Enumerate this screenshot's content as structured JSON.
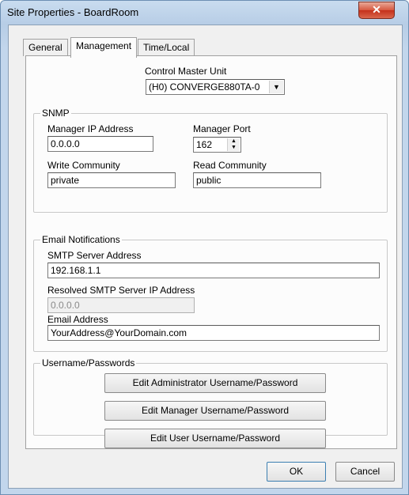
{
  "window": {
    "title": "Site Properties - BoardRoom",
    "close_glyph": "✕"
  },
  "tabs": [
    "General",
    "Management",
    "Time/Local"
  ],
  "control_master": {
    "label": "Control Master Unit",
    "value": "(H0) CONVERGE880TA-0"
  },
  "snmp": {
    "title": "SNMP",
    "manager_ip_label": "Manager IP Address",
    "manager_ip_value": "0.0.0.0",
    "manager_port_label": "Manager Port",
    "manager_port_value": "162",
    "write_community_label": "Write Community",
    "write_community_value": "private",
    "read_community_label": "Read Community",
    "read_community_value": "public"
  },
  "email": {
    "title": "Email Notifications",
    "smtp_label": "SMTP Server Address",
    "smtp_value": "192.168.1.1",
    "resolved_label": "Resolved SMTP Server IP Address",
    "resolved_value": "0.0.0.0",
    "address_label": "Email Address",
    "address_value": "YourAddress@YourDomain.com"
  },
  "passwords": {
    "title": "Username/Passwords",
    "admin_button": "Edit Administrator Username/Password",
    "manager_button": "Edit Manager Username/Password",
    "user_button": "Edit User Username/Password"
  },
  "footer": {
    "ok": "OK",
    "cancel": "Cancel"
  },
  "icons": {
    "dropdown": "chevron-down-icon",
    "spin_up": "arrow-up-icon",
    "spin_down": "arrow-down-icon"
  }
}
